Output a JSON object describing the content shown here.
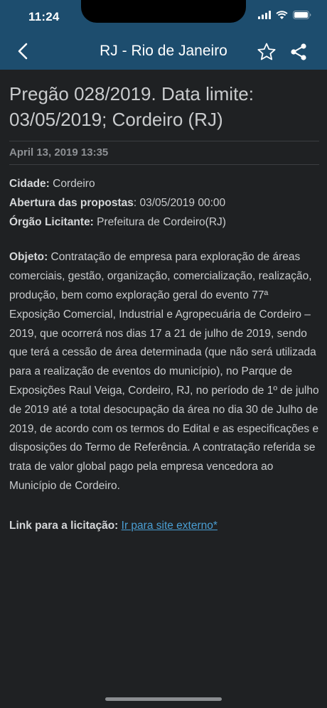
{
  "status_bar": {
    "time": "11:24"
  },
  "nav": {
    "title": "RJ - Rio de Janeiro",
    "icons": [
      "chevron-left-icon",
      "star-outline-icon",
      "share-icon"
    ]
  },
  "article": {
    "title": "Pregão 028/2019. Data limite: 03/05/2019; Cordeiro (RJ)",
    "date": "April 13, 2019 13:35",
    "fields": [
      {
        "label": "Cidade:",
        "value": " Cordeiro"
      },
      {
        "label": "Abertura das propostas",
        "value": ": 03/05/2019 00:00"
      },
      {
        "label": "Órgão Licitante:",
        "value": " Prefeitura de Cordeiro(RJ)"
      }
    ],
    "object_label": "Objeto:",
    "object_text": " Contratação de empresa para exploração de áreas comerciais, gestão, organização, comercialização, realização, produção, bem como exploração geral do evento 77ª Exposição Comercial, Industrial e Agropecuária de Cordeiro – 2019, que ocorrerá nos dias 17 a 21 de julho de 2019, sendo que terá a cessão de área determinada (que não será utilizada para a realização de eventos do município), no Parque de Exposições Raul Veiga, Cordeiro, RJ, no período de 1º de julho de 2019 até a total desocupação da área no dia 30 de Julho de 2019, de acordo com os termos do Edital e as especificações e disposições do Termo de Referência. A contratação referida se trata de valor global pago pela empresa vencedora ao Município de Cordeiro.",
    "link_label": "Link para a licitação:",
    "link_text": "Ir para site externo*"
  },
  "colors": {
    "header": "#1d4d6e",
    "background": "#1f2123",
    "text": "#c9cbcd",
    "link": "#4a9fd4"
  }
}
